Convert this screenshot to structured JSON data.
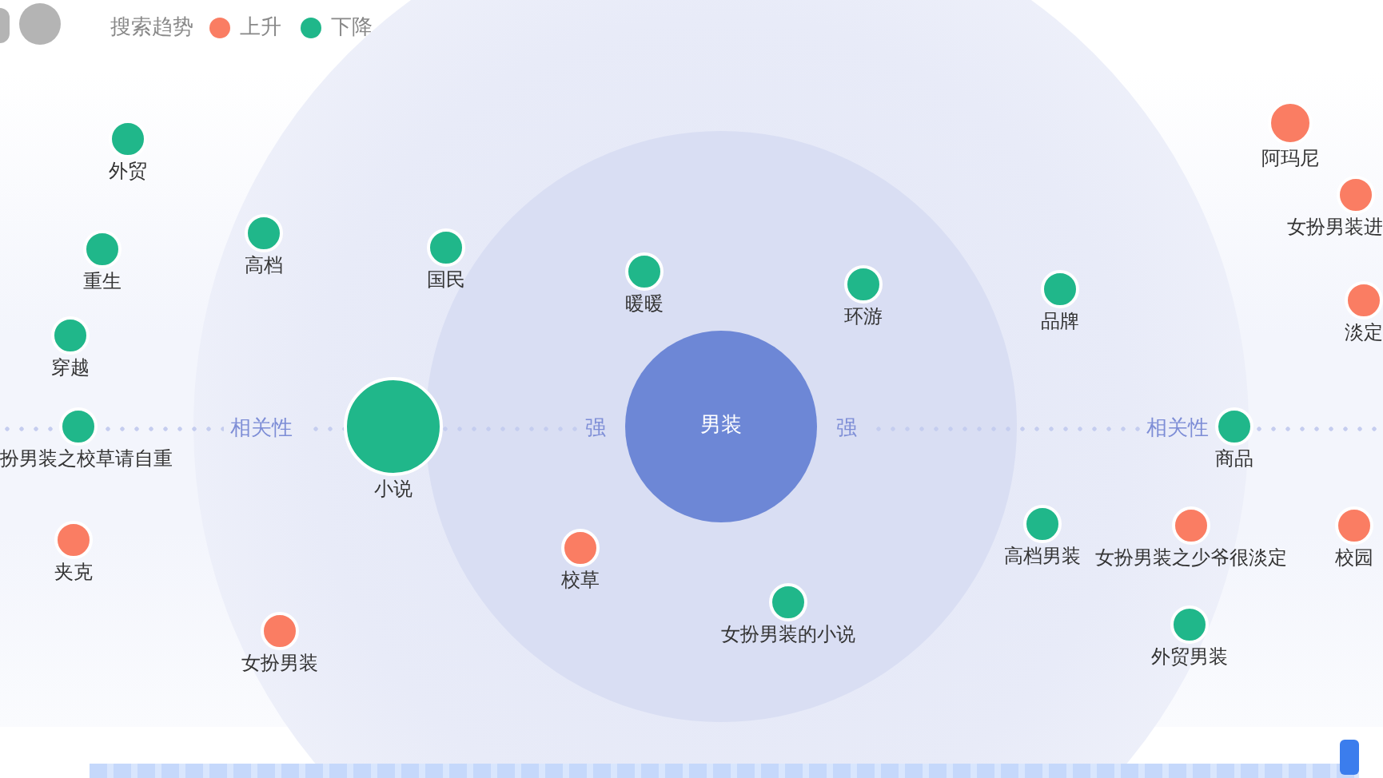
{
  "legend": {
    "title": "搜索趋势",
    "items": [
      {
        "label": "上升",
        "color": "#fa7d63"
      },
      {
        "label": "下降",
        "color": "#20b78a"
      }
    ]
  },
  "center": {
    "label": "男装"
  },
  "axis_labels": [
    "相关性",
    "强",
    "强",
    "相关性"
  ],
  "nodes": [
    {
      "label": "外贸",
      "color": "#20b78a"
    },
    {
      "label": "重生",
      "color": "#20b78a"
    },
    {
      "label": "穿越",
      "color": "#20b78a"
    },
    {
      "label": "扮男装之校草请自重",
      "color": "#20b78a"
    },
    {
      "label": "夹克",
      "color": "#fa7d63"
    },
    {
      "label": "女扮男装",
      "color": "#fa7d63"
    },
    {
      "label": "高档",
      "color": "#20b78a"
    },
    {
      "label": "国民",
      "color": "#20b78a"
    },
    {
      "label": "小说",
      "color": "#20b78a"
    },
    {
      "label": "暖暖",
      "color": "#20b78a"
    },
    {
      "label": "环游",
      "color": "#20b78a"
    },
    {
      "label": "校草",
      "color": "#fa7d63"
    },
    {
      "label": "女扮男装的小说",
      "color": "#20b78a"
    },
    {
      "label": "品牌",
      "color": "#20b78a"
    },
    {
      "label": "阿玛尼",
      "color": "#fa7d63"
    },
    {
      "label": "女扮男装进",
      "color": "#fa7d63"
    },
    {
      "label": "淡定",
      "color": "#fa7d63"
    },
    {
      "label": "商品",
      "color": "#20b78a"
    },
    {
      "label": "高档男装",
      "color": "#20b78a"
    },
    {
      "label": "女扮男装之少爷很淡定",
      "color": "#fa7d63"
    },
    {
      "label": "校园",
      "color": "#fa7d63"
    },
    {
      "label": "外贸男装",
      "color": "#20b78a"
    }
  ],
  "timeline": {
    "level": 1
  }
}
